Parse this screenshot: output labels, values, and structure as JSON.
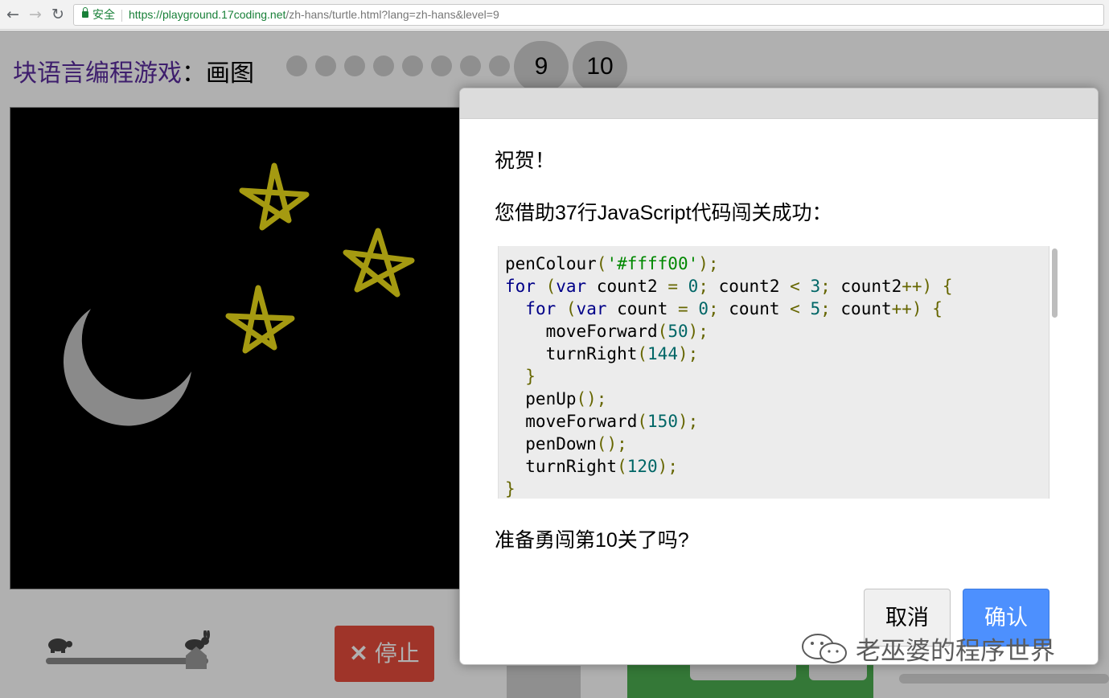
{
  "browser": {
    "secure_label": "安全",
    "url_host": "https://playground.17coding.net",
    "url_path": "/zh-hans/turtle.html?lang=zh-hans&level=9",
    "back_glyph": "←",
    "forward_glyph": "→",
    "reload_glyph": "↻"
  },
  "page": {
    "title_main": "块语言编程游戏",
    "title_sep": "：",
    "title_sub": "画图",
    "levels": [
      "9",
      "10"
    ],
    "current_level": "9",
    "stop_icon": "✕",
    "stop_label": "停止",
    "colors": {
      "canvas_bg": "#000000",
      "stars": "#f0e01a",
      "moon": "#c8c8c8",
      "stop_button": "#e74c3c"
    }
  },
  "dialog": {
    "congrats": "祝贺！",
    "message": "您借助37行JavaScript代码闯关成功：",
    "question": "准备勇闯第10关了吗?",
    "cancel_label": "取消",
    "confirm_label": "确认",
    "colors": {
      "confirm": "#4d90fe"
    },
    "code_lines": [
      [
        {
          "t": "penColour",
          "c": ""
        },
        {
          "t": "(",
          "c": "pun"
        },
        {
          "t": "'#ffff00'",
          "c": "str"
        },
        {
          "t": ");",
          "c": "pun"
        }
      ],
      [
        {
          "t": "for",
          "c": "kw"
        },
        {
          "t": " ",
          "c": ""
        },
        {
          "t": "(",
          "c": "pun"
        },
        {
          "t": "var",
          "c": "kw"
        },
        {
          "t": " count2 ",
          "c": ""
        },
        {
          "t": "=",
          "c": "pun"
        },
        {
          "t": " ",
          "c": ""
        },
        {
          "t": "0",
          "c": "num"
        },
        {
          "t": ";",
          "c": "pun"
        },
        {
          "t": " count2 ",
          "c": ""
        },
        {
          "t": "<",
          "c": "pun"
        },
        {
          "t": " ",
          "c": ""
        },
        {
          "t": "3",
          "c": "num"
        },
        {
          "t": ";",
          "c": "pun"
        },
        {
          "t": " count2",
          "c": ""
        },
        {
          "t": "++)",
          "c": "pun"
        },
        {
          "t": " ",
          "c": ""
        },
        {
          "t": "{",
          "c": "pun"
        }
      ],
      [
        {
          "t": "  ",
          "c": ""
        },
        {
          "t": "for",
          "c": "kw"
        },
        {
          "t": " ",
          "c": ""
        },
        {
          "t": "(",
          "c": "pun"
        },
        {
          "t": "var",
          "c": "kw"
        },
        {
          "t": " count ",
          "c": ""
        },
        {
          "t": "=",
          "c": "pun"
        },
        {
          "t": " ",
          "c": ""
        },
        {
          "t": "0",
          "c": "num"
        },
        {
          "t": ";",
          "c": "pun"
        },
        {
          "t": " count ",
          "c": ""
        },
        {
          "t": "<",
          "c": "pun"
        },
        {
          "t": " ",
          "c": ""
        },
        {
          "t": "5",
          "c": "num"
        },
        {
          "t": ";",
          "c": "pun"
        },
        {
          "t": " count",
          "c": ""
        },
        {
          "t": "++)",
          "c": "pun"
        },
        {
          "t": " ",
          "c": ""
        },
        {
          "t": "{",
          "c": "pun"
        }
      ],
      [
        {
          "t": "    moveForward",
          "c": ""
        },
        {
          "t": "(",
          "c": "pun"
        },
        {
          "t": "50",
          "c": "num"
        },
        {
          "t": ");",
          "c": "pun"
        }
      ],
      [
        {
          "t": "    turnRight",
          "c": ""
        },
        {
          "t": "(",
          "c": "pun"
        },
        {
          "t": "144",
          "c": "num"
        },
        {
          "t": ");",
          "c": "pun"
        }
      ],
      [
        {
          "t": "  ",
          "c": ""
        },
        {
          "t": "}",
          "c": "pun"
        }
      ],
      [
        {
          "t": "  penUp",
          "c": ""
        },
        {
          "t": "();",
          "c": "pun"
        }
      ],
      [
        {
          "t": "  moveForward",
          "c": ""
        },
        {
          "t": "(",
          "c": "pun"
        },
        {
          "t": "150",
          "c": "num"
        },
        {
          "t": ");",
          "c": "pun"
        }
      ],
      [
        {
          "t": "  penDown",
          "c": ""
        },
        {
          "t": "();",
          "c": "pun"
        }
      ],
      [
        {
          "t": "  turnRight",
          "c": ""
        },
        {
          "t": "(",
          "c": "pun"
        },
        {
          "t": "120",
          "c": "num"
        },
        {
          "t": ");",
          "c": "pun"
        }
      ],
      [
        {
          "t": "}",
          "c": "pun"
        }
      ]
    ]
  },
  "watermark": {
    "text": "老巫婆的程序世界"
  },
  "icons": {
    "back": "back-arrow-icon",
    "forward": "forward-arrow-icon",
    "reload": "reload-icon",
    "lock": "lock-icon",
    "turtle": "turtle-icon",
    "rabbit": "rabbit-icon",
    "stop": "close-icon",
    "watermark": "wechat-icon"
  }
}
